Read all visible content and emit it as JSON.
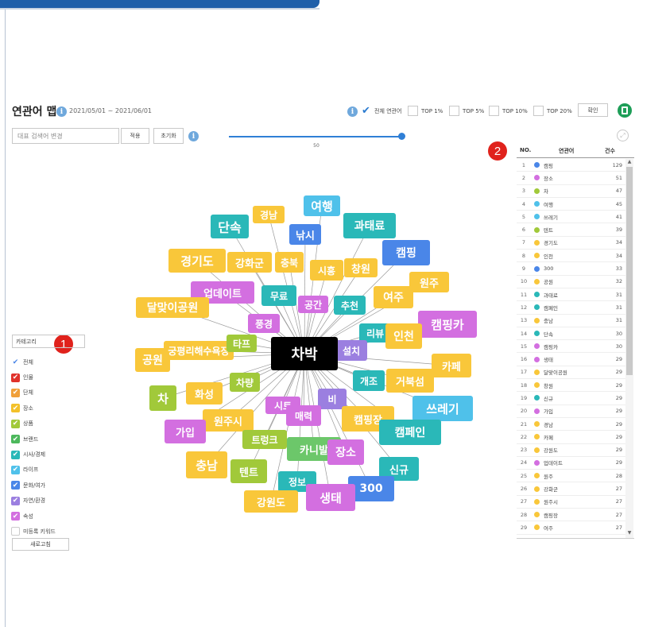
{
  "colors": {
    "frame_blue": "#1f5fa9",
    "accent": "#2f7fd6",
    "badge": "#e0221c",
    "center": "#000000",
    "yellow": "#f9c73a",
    "teal": "#2ab8b8",
    "blue": "#4a86e8",
    "lightblue": "#4fc1ea",
    "purple": "#9b7fe0",
    "pink": "#d36fe0",
    "green": "#a1c93a",
    "lightgreen": "#6cc76a"
  },
  "header": {
    "title": "연관어 맵",
    "date_range": "2021/05/01 ~ 2021/06/01",
    "filters": [
      {
        "label": "전체 연관어",
        "checked": true
      },
      {
        "label": "TOP 1%",
        "checked": false
      },
      {
        "label": "TOP 5%",
        "checked": false
      },
      {
        "label": "TOP 10%",
        "checked": false
      },
      {
        "label": "TOP 20%",
        "checked": false
      }
    ],
    "confirm_label": "확인",
    "excel_icon": "excel-icon",
    "info_icon": "info-icon"
  },
  "search": {
    "placeholder": "대표 검색어 변경",
    "apply_label": "적용",
    "reset_label": "초기화"
  },
  "slider": {
    "value": 50,
    "max": 50
  },
  "badges": [
    "1",
    "2"
  ],
  "category_panel": {
    "select_label": "카테고리",
    "items": [
      {
        "label": "전체",
        "color": "#4a86e8",
        "checked": true,
        "style": "check"
      },
      {
        "label": "인물",
        "color": "#e0322c",
        "checked": true
      },
      {
        "label": "단체",
        "color": "#f0a03a",
        "checked": true
      },
      {
        "label": "장소",
        "color": "#f3c12a",
        "checked": true
      },
      {
        "label": "상품",
        "color": "#a1c93a",
        "checked": true
      },
      {
        "label": "브랜드",
        "color": "#4cb85c",
        "checked": true
      },
      {
        "label": "시사/경제",
        "color": "#2ab8b8",
        "checked": true
      },
      {
        "label": "라이프",
        "color": "#4fc1ea",
        "checked": true
      },
      {
        "label": "문화/여가",
        "color": "#4a86e8",
        "checked": true
      },
      {
        "label": "자연/환경",
        "color": "#9b7fe0",
        "checked": true
      },
      {
        "label": "속성",
        "color": "#d36fe0",
        "checked": true
      },
      {
        "label": "미등록 키워드",
        "color": "#ffffff",
        "checked": false
      }
    ],
    "refresh_label": "새로고침"
  },
  "network": {
    "center": "차박",
    "nodes": [
      {
        "label": "단속",
        "color": "#2ab8b8"
      },
      {
        "label": "경남",
        "color": "#f9c73a"
      },
      {
        "label": "여행",
        "color": "#4fc1ea"
      },
      {
        "label": "과태료",
        "color": "#2ab8b8"
      },
      {
        "label": "낚시",
        "color": "#4a86e8"
      },
      {
        "label": "캠핑",
        "color": "#4a86e8"
      },
      {
        "label": "경기도",
        "color": "#f9c73a"
      },
      {
        "label": "강화군",
        "color": "#f9c73a"
      },
      {
        "label": "충북",
        "color": "#f9c73a"
      },
      {
        "label": "시흥",
        "color": "#f9c73a"
      },
      {
        "label": "창원",
        "color": "#f9c73a"
      },
      {
        "label": "원주",
        "color": "#f9c73a"
      },
      {
        "label": "업데이트",
        "color": "#d36fe0"
      },
      {
        "label": "무료",
        "color": "#2ab8b8"
      },
      {
        "label": "공간",
        "color": "#d36fe0"
      },
      {
        "label": "추천",
        "color": "#2ab8b8"
      },
      {
        "label": "여주",
        "color": "#f9c73a"
      },
      {
        "label": "달맞이공원",
        "color": "#f9c73a"
      },
      {
        "label": "풍경",
        "color": "#d36fe0"
      },
      {
        "label": "캠핑카",
        "color": "#d36fe0"
      },
      {
        "label": "리뷰",
        "color": "#2ab8b8"
      },
      {
        "label": "인천",
        "color": "#f9c73a"
      },
      {
        "label": "공원",
        "color": "#f9c73a"
      },
      {
        "label": "궁평리해수욕장",
        "color": "#f9c73a"
      },
      {
        "label": "타프",
        "color": "#a1c93a"
      },
      {
        "label": "설치",
        "color": "#9b7fe0"
      },
      {
        "label": "카페",
        "color": "#f9c73a"
      },
      {
        "label": "차량",
        "color": "#a1c93a"
      },
      {
        "label": "개조",
        "color": "#2ab8b8"
      },
      {
        "label": "거북섬",
        "color": "#f9c73a"
      },
      {
        "label": "차",
        "color": "#a1c93a"
      },
      {
        "label": "화성",
        "color": "#f9c73a"
      },
      {
        "label": "비",
        "color": "#9b7fe0"
      },
      {
        "label": "시트",
        "color": "#d36fe0"
      },
      {
        "label": "쓰레기",
        "color": "#4fc1ea"
      },
      {
        "label": "원주시",
        "color": "#f9c73a"
      },
      {
        "label": "매력",
        "color": "#d36fe0"
      },
      {
        "label": "캠핑장",
        "color": "#f9c73a"
      },
      {
        "label": "가입",
        "color": "#d36fe0"
      },
      {
        "label": "트렁크",
        "color": "#a1c93a"
      },
      {
        "label": "캠페인",
        "color": "#2ab8b8"
      },
      {
        "label": "카니발",
        "color": "#6cc76a"
      },
      {
        "label": "장소",
        "color": "#d36fe0"
      },
      {
        "label": "충남",
        "color": "#f9c73a"
      },
      {
        "label": "텐트",
        "color": "#a1c93a"
      },
      {
        "label": "신규",
        "color": "#2ab8b8"
      },
      {
        "label": "정보",
        "color": "#2ab8b8"
      },
      {
        "label": "300",
        "color": "#4a86e8"
      },
      {
        "label": "강원도",
        "color": "#f9c73a"
      },
      {
        "label": "생태",
        "color": "#d36fe0"
      }
    ]
  },
  "table": {
    "headers": {
      "no": "NO.",
      "word": "연관어",
      "count": "건수"
    },
    "rows": [
      {
        "no": "1",
        "word": "캠핑",
        "count": "129",
        "color": "#4a86e8"
      },
      {
        "no": "2",
        "word": "장소",
        "count": "51",
        "color": "#d36fe0"
      },
      {
        "no": "3",
        "word": "차",
        "count": "47",
        "color": "#a1c93a"
      },
      {
        "no": "4",
        "word": "여행",
        "count": "45",
        "color": "#4fc1ea"
      },
      {
        "no": "5",
        "word": "쓰레기",
        "count": "41",
        "color": "#4fc1ea"
      },
      {
        "no": "6",
        "word": "텐트",
        "count": "39",
        "color": "#a1c93a"
      },
      {
        "no": "7",
        "word": "경기도",
        "count": "34",
        "color": "#f9c73a"
      },
      {
        "no": "8",
        "word": "인천",
        "count": "34",
        "color": "#f9c73a"
      },
      {
        "no": "9",
        "word": "300",
        "count": "33",
        "color": "#4a86e8"
      },
      {
        "no": "10",
        "word": "공원",
        "count": "32",
        "color": "#f9c73a"
      },
      {
        "no": "11",
        "word": "과태료",
        "count": "31",
        "color": "#2ab8b8"
      },
      {
        "no": "12",
        "word": "캠페인",
        "count": "31",
        "color": "#2ab8b8"
      },
      {
        "no": "13",
        "word": "충남",
        "count": "31",
        "color": "#f9c73a"
      },
      {
        "no": "14",
        "word": "단속",
        "count": "30",
        "color": "#2ab8b8"
      },
      {
        "no": "15",
        "word": "캠핑카",
        "count": "30",
        "color": "#d36fe0"
      },
      {
        "no": "16",
        "word": "생태",
        "count": "29",
        "color": "#d36fe0"
      },
      {
        "no": "17",
        "word": "달맞이공원",
        "count": "29",
        "color": "#f9c73a"
      },
      {
        "no": "18",
        "word": "창원",
        "count": "29",
        "color": "#f9c73a"
      },
      {
        "no": "19",
        "word": "신규",
        "count": "29",
        "color": "#2ab8b8"
      },
      {
        "no": "20",
        "word": "가입",
        "count": "29",
        "color": "#d36fe0"
      },
      {
        "no": "21",
        "word": "경남",
        "count": "29",
        "color": "#f9c73a"
      },
      {
        "no": "22",
        "word": "카페",
        "count": "29",
        "color": "#f9c73a"
      },
      {
        "no": "23",
        "word": "강원도",
        "count": "29",
        "color": "#f9c73a"
      },
      {
        "no": "24",
        "word": "업데이트",
        "count": "29",
        "color": "#d36fe0"
      },
      {
        "no": "25",
        "word": "원주",
        "count": "28",
        "color": "#f9c73a"
      },
      {
        "no": "26",
        "word": "강화군",
        "count": "27",
        "color": "#f9c73a"
      },
      {
        "no": "27",
        "word": "원주시",
        "count": "27",
        "color": "#f9c73a"
      },
      {
        "no": "28",
        "word": "캠핑장",
        "count": "27",
        "color": "#f9c73a"
      },
      {
        "no": "29",
        "word": "여주",
        "count": "27",
        "color": "#f9c73a"
      }
    ]
  }
}
